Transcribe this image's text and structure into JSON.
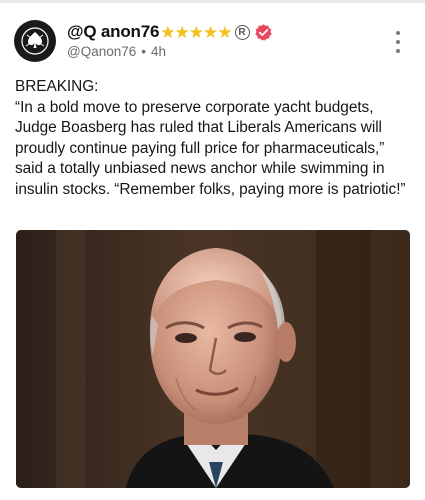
{
  "post": {
    "display_name": "@Q anon76",
    "stars": [
      "★",
      "★",
      "★",
      "★",
      "★"
    ],
    "registered_mark": "R",
    "handle": "@Qanon76",
    "separator": "•",
    "time_ago": "4h",
    "body": "BREAKING:\n“In a bold move to preserve corporate yacht budgets, Judge Boasberg has ruled that Liberals Americans will proudly continue paying full price for pharmaceuticals,” said a totally unbiased news anchor while swimming in insulin stocks. “Remember folks, paying more is patriotic!”"
  },
  "icons": {
    "avatar": "spade-logo-icon",
    "verified": "verified-badge-icon",
    "more": "more-vertical-icon"
  },
  "colors": {
    "star": "#f3c01d",
    "verified_badge": "#e8455f",
    "meta_text": "#6b6b6b"
  }
}
